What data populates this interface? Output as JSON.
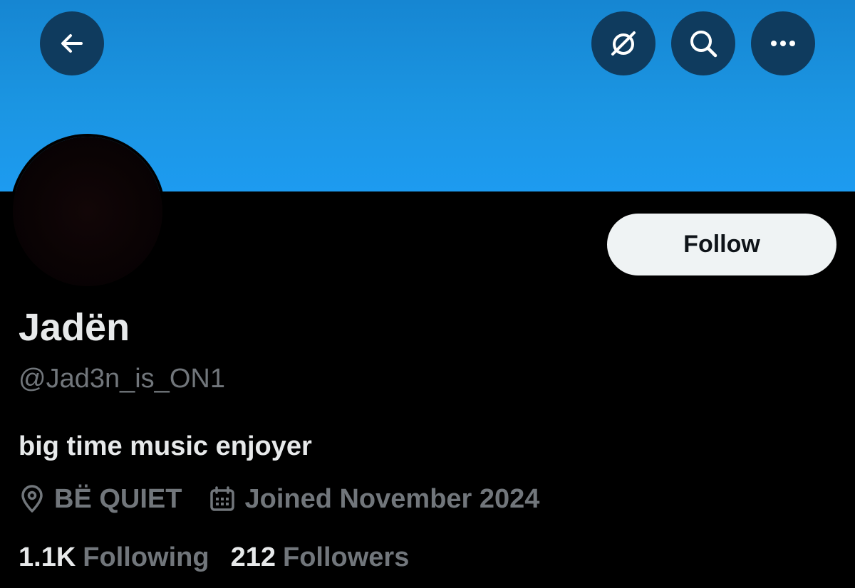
{
  "profile": {
    "display_name": "Jadën",
    "handle": "@Jad3n_is_ON1",
    "bio": "big time music enjoyer",
    "location": "BË QUIET",
    "joined": "Joined November 2024",
    "following_count": "1.1K",
    "following_label": "Following",
    "followers_count": "212",
    "followers_label": "Followers"
  },
  "actions": {
    "follow_label": "Follow"
  },
  "icons": {
    "back": "back-arrow-icon",
    "grok": "grok-icon",
    "search": "search-icon",
    "more": "more-dots-icon",
    "location": "location-pin-icon",
    "calendar": "calendar-icon"
  },
  "colors": {
    "banner": "#1d9bf0",
    "background": "#000000",
    "primary_text": "#e7e9ea",
    "secondary_text": "#71767b",
    "follow_button_bg": "#eff3f4",
    "header_button_bg": "#0f3b5e"
  }
}
